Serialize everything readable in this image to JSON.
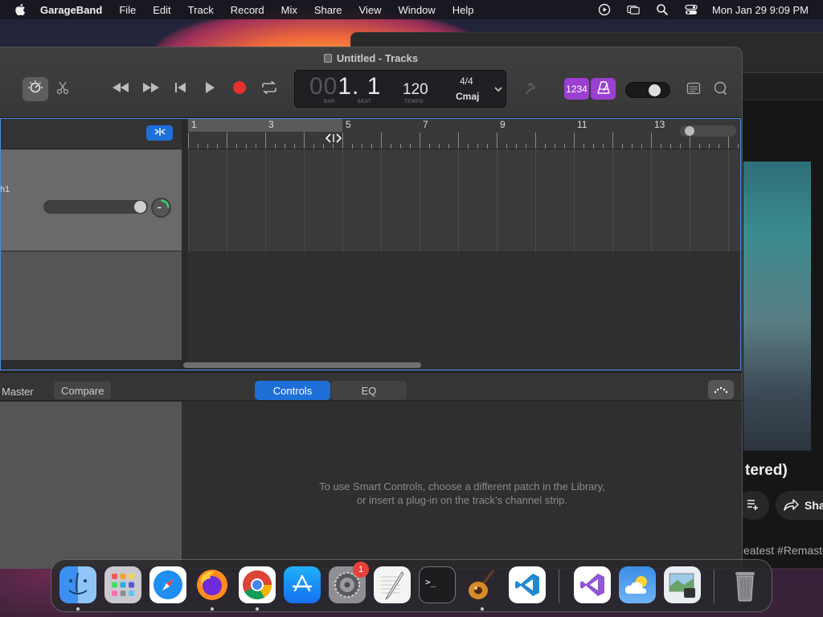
{
  "menubar": {
    "app_name": "GarageBand",
    "items": [
      "File",
      "Edit",
      "Track",
      "Record",
      "Mix",
      "Share",
      "View",
      "Window",
      "Help"
    ],
    "clock": "Mon Jan 29  9:09 PM"
  },
  "browser": {
    "video_title_fragment": "tered)",
    "share_label": "Sha",
    "hashtags_fragment": "eatest #Remaste"
  },
  "garageband": {
    "window_title": "Untitled - Tracks",
    "lcd": {
      "bar_dim": "00",
      "bar_value": "1.",
      "beat_value": " 1",
      "bar_label": "BAR",
      "beat_label": "BEAT",
      "tempo": "120",
      "tempo_label": "TEMPO",
      "time_signature": "4/4",
      "key": "Cmaj"
    },
    "count_in_label": "1234",
    "track": {
      "name_fragment": "h1"
    },
    "ruler_numbers": [
      "1",
      "3",
      "5",
      "7",
      "9",
      "11",
      "13"
    ],
    "smart_controls": {
      "tab_master": "Master",
      "tab_compare": "Compare",
      "seg_controls": "Controls",
      "seg_eq": "EQ",
      "message_line1": "To use Smart Controls, choose a different patch in the Library,",
      "message_line2": "or insert a plug-in on the track’s channel strip."
    }
  },
  "dock": {
    "settings_badge": "1"
  },
  "colors": {
    "accent_blue": "#1f6fd8",
    "record_red": "#e8302e",
    "purple": "#9b3fd0",
    "selection_border": "#4d8ce8"
  }
}
